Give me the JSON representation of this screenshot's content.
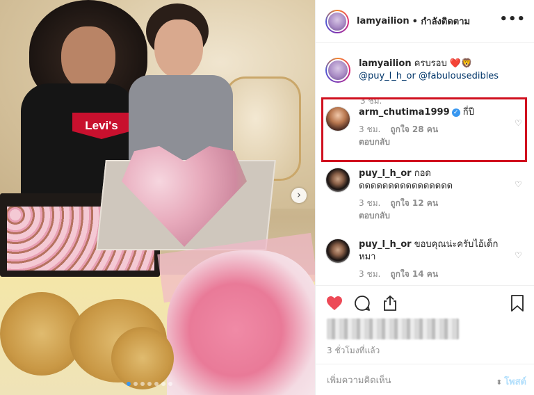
{
  "post": {
    "username": "lamyailion",
    "follow_status": "• กำลังติดตาม",
    "more_icon": "more-horizontal-icon",
    "image": {
      "shirt_logo_text": "Levi's",
      "carousel_count": 7,
      "carousel_active": 1
    }
  },
  "caption": {
    "username": "lamyailion",
    "text": "ครบรอบ",
    "emojis": "❤️🦁",
    "mentions": "@puy_l_h_or @fabulousedibles",
    "time": "3 ชม."
  },
  "comments": [
    {
      "username": "arm_chutima1999",
      "verified": true,
      "text": "กี่ปี",
      "time": "3 ชม.",
      "likes": "ถูกใจ 28 คน",
      "reply": "ตอบกลับ",
      "highlighted": true
    },
    {
      "username": "puy_l_h_or",
      "verified": false,
      "text": "กอด ดดดดดดดดดดดดดดดด",
      "time": "3 ชม.",
      "likes": "ถูกใจ 12 คน",
      "reply": "ตอบกลับ"
    },
    {
      "username": "puy_l_h_or",
      "verified": false,
      "text": "ขอบคุณน่ะครับไอ้เด็กหมา",
      "time": "3 ชม.",
      "likes": "ถูกใจ 14 คน"
    }
  ],
  "actions": {
    "like_icon": "heart-filled-icon",
    "comment_icon": "comment-bubble-icon",
    "share_icon": "share-upload-icon",
    "save_icon": "bookmark-icon",
    "like_color": "#ed4956",
    "time_ago": "3 ชั่วโมงที่แล้ว"
  },
  "add_comment": {
    "placeholder": "เพิ่มความคิดเห็น",
    "post_label": "โพสต์"
  },
  "colors": {
    "highlight_box": "#d0101f",
    "link_blue": "#003569",
    "verified_blue": "#3897f0"
  }
}
